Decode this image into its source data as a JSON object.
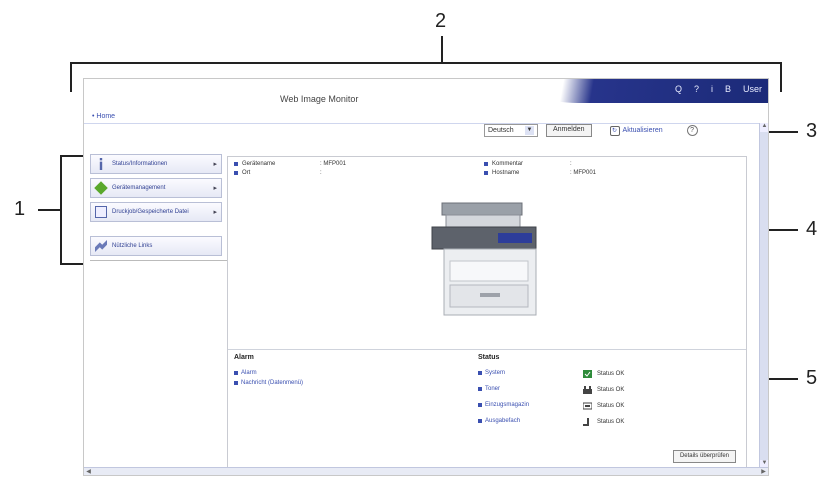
{
  "callouts": [
    "1",
    "2",
    "3",
    "4",
    "5"
  ],
  "window": {
    "app_title": "Web Image Monitor",
    "top_icons": [
      "Q",
      "?",
      "i",
      "B",
      "User"
    ]
  },
  "home_link": "• Home",
  "toolbar": {
    "language": "Deutsch",
    "change_button": "Anmelden",
    "refresh_label": "Aktualisieren",
    "help_icon": "?"
  },
  "sidebar": {
    "items": [
      {
        "label": "Status/Informationen",
        "icon": "info-icon"
      },
      {
        "label": "Gerätemanagement",
        "icon": "diamond-icon"
      },
      {
        "label": "Druckjob/Gespeicherte Datei",
        "icon": "document-icon"
      },
      {
        "label": "Nützliche Links",
        "icon": "link-icon"
      }
    ]
  },
  "device_info": {
    "name_label": "Gerätename",
    "name_value": ": MFP001",
    "location_label": "Ort",
    "location_value": ":",
    "comment_label": "Kommentar",
    "comment_value": ":",
    "host_label": "Hostname",
    "host_value": ": MFP001"
  },
  "alarm": {
    "title": "Alarm",
    "items": [
      "Alarm",
      "Nachricht (Datenmenü)"
    ]
  },
  "status": {
    "title": "Status",
    "items": [
      {
        "label": "System",
        "value": "Status OK"
      },
      {
        "label": "Toner",
        "value": "Status OK"
      },
      {
        "label": "Einzugsmagazin",
        "value": "Status OK"
      },
      {
        "label": "Ausgabefach",
        "value": "Status OK"
      }
    ]
  },
  "details_button": "Details überprüfen",
  "colors": {
    "accent": "#27348b",
    "link": "#3a4fb0",
    "status_ok": "#2e8b3a"
  }
}
